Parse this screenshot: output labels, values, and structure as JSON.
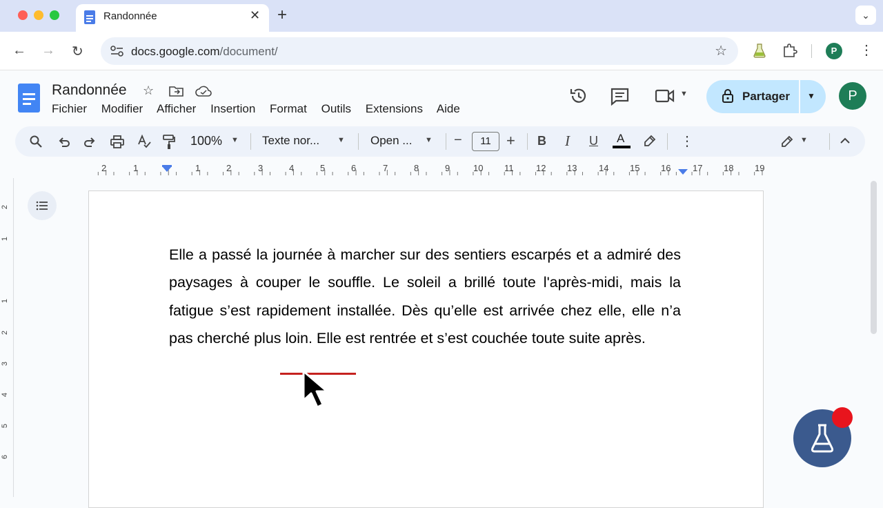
{
  "browser": {
    "tab_title": "Randonnée",
    "url_host": "docs.google.com",
    "url_path": "/document/",
    "profile_initial": "P"
  },
  "docs": {
    "title": "Randonnée",
    "menu": [
      "Fichier",
      "Modifier",
      "Afficher",
      "Insertion",
      "Format",
      "Outils",
      "Extensions",
      "Aide"
    ],
    "share_label": "Partager",
    "profile_initial": "P"
  },
  "toolbar": {
    "zoom": "100%",
    "style": "Texte nor...",
    "font": "Open ...",
    "font_size": "11",
    "decrease": "−",
    "increase": "+",
    "bold": "B",
    "italic": "I",
    "underline": "U",
    "text_color": "A"
  },
  "ruler": {
    "labels": [
      "2",
      "1",
      "1",
      "2",
      "3",
      "4",
      "5",
      "6",
      "7",
      "8",
      "9",
      "10",
      "11",
      "12",
      "13",
      "14",
      "15",
      "16",
      "17",
      "18",
      "19"
    ],
    "vertical_labels": [
      "2",
      "1",
      "1",
      "2",
      "3",
      "4",
      "5",
      "6"
    ]
  },
  "document": {
    "paragraph_before": "Elle a passé la journée à marcher sur des sentiers escarpés et a admiré des paysages à couper le souffle. Le soleil a brillé toute l'après-midi, mais la fatigue s’est rapidement installée. Dès qu’elle est arrivée chez elle, elle n’a pas cherché plus loin. Elle est rentrée et s’est couchée ",
    "flagged_phrase": "toute suite",
    "paragraph_after": " après."
  },
  "colors": {
    "tab_strip": "#dae2f7",
    "share_button": "#c2e7ff",
    "docs_blue": "#4285f4",
    "avatar_green": "#1e7d57",
    "underline_red": "#c5221f",
    "lab_button": "#3b5a8e",
    "notification_red": "#e8141d"
  },
  "icons": [
    "search-icon",
    "undo-icon",
    "redo-icon",
    "print-icon",
    "spellcheck-icon",
    "paint-format-icon",
    "bold-icon",
    "italic-icon",
    "underline-icon",
    "text-color-icon",
    "highlighter-icon",
    "more-icon",
    "pencil-icon",
    "chevron-up-icon",
    "history-icon",
    "comment-icon",
    "video-icon",
    "lock-icon",
    "star-icon",
    "move-folder-icon",
    "cloud-icon",
    "outline-icon",
    "lab-flask-icon"
  ]
}
